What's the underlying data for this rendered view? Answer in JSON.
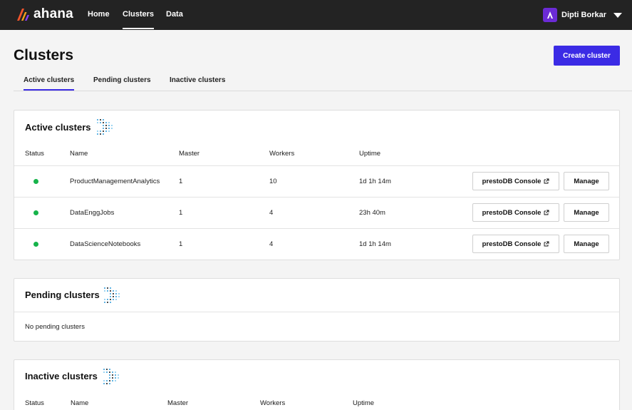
{
  "brand": {
    "name": "ahana"
  },
  "nav": {
    "home": "Home",
    "clusters": "Clusters",
    "data": "Data"
  },
  "user": {
    "name": "Dipti Borkar"
  },
  "page": {
    "title": "Clusters",
    "create_button": "Create cluster"
  },
  "tabs": [
    {
      "label": "Active clusters",
      "active": true
    },
    {
      "label": "Pending clusters",
      "active": false
    },
    {
      "label": "Inactive clusters",
      "active": false
    }
  ],
  "columns": {
    "status": "Status",
    "name": "Name",
    "master": "Master",
    "workers": "Workers",
    "uptime": "Uptime"
  },
  "active": {
    "title": "Active clusters",
    "rows": [
      {
        "name": "ProductManagementAnalytics",
        "master": "1",
        "workers": "10",
        "uptime": "1d 1h 14m",
        "console": "prestoDB Console",
        "manage": "Manage"
      },
      {
        "name": "DataEnggJobs",
        "master": "1",
        "workers": "4",
        "uptime": "23h 40m",
        "console": "prestoDB Console",
        "manage": "Manage"
      },
      {
        "name": "DataScienceNotebooks",
        "master": "1",
        "workers": "4",
        "uptime": "1d 1h 14m",
        "console": "prestoDB Console",
        "manage": "Manage"
      }
    ]
  },
  "pending": {
    "title": "Pending clusters",
    "empty": "No pending clusters"
  },
  "inactive": {
    "title": "Inactive clusters"
  },
  "colors": {
    "accent": "#3b2be5",
    "status_running": "#16b34a",
    "topbar": "#232323",
    "avatar": "#6b2bd6"
  },
  "icons": {
    "logo": "ahana-logo-icon",
    "avatar": "user-avatar-icon",
    "caret": "caret-down-icon",
    "external": "external-link-icon",
    "dots": "presto-dots-icon"
  }
}
